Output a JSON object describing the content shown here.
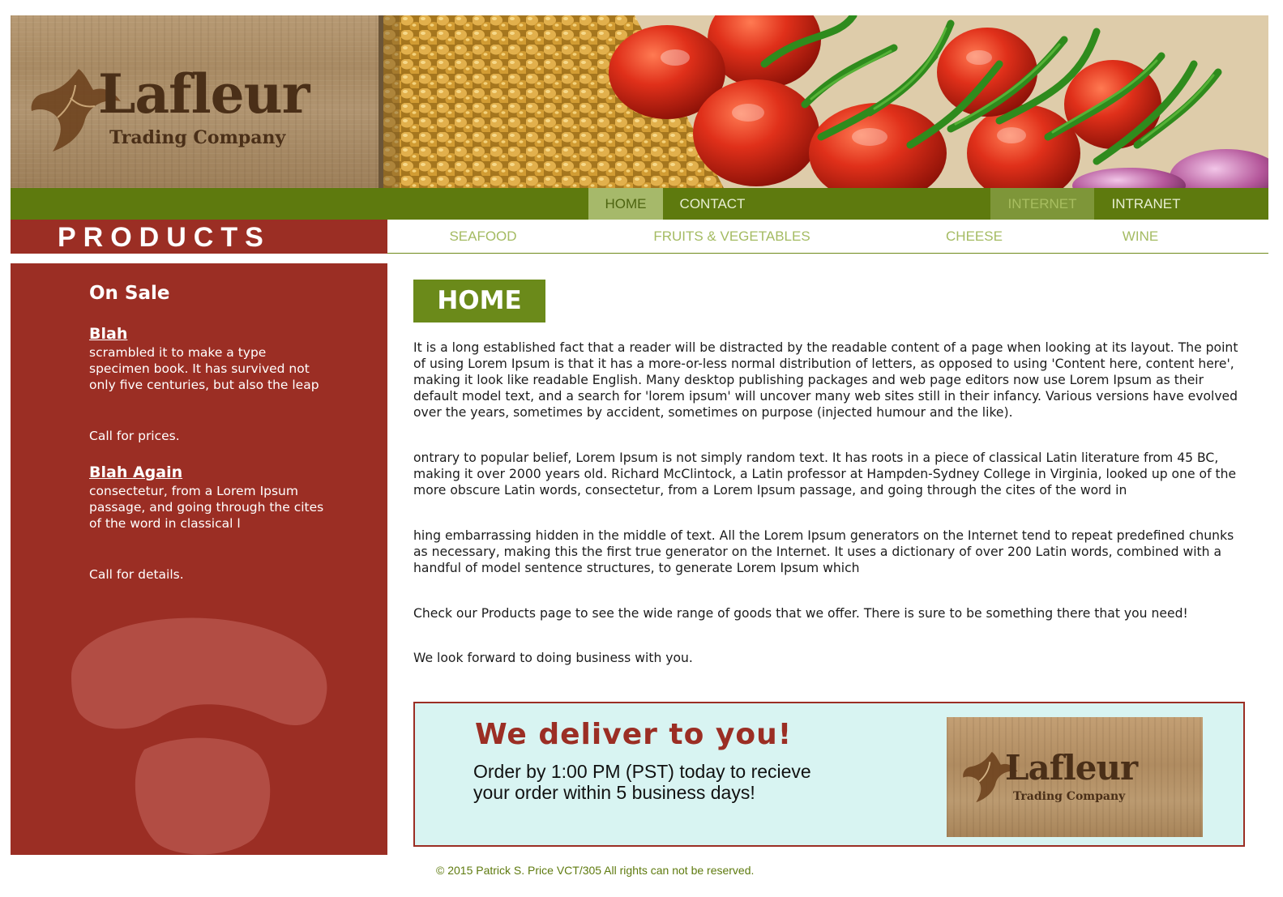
{
  "banner": {
    "logo_word": "Lafleur",
    "logo_sub": "Trading Company"
  },
  "nav": {
    "left": [
      {
        "label": "HOME",
        "active": true
      },
      {
        "label": "CONTACT",
        "active": false
      }
    ],
    "right": [
      {
        "label": "INTERNET",
        "active": true
      },
      {
        "label": "INTRANET",
        "active": false
      }
    ]
  },
  "products": {
    "title": "PRODUCTS",
    "categories": [
      "SEAFOOD",
      "FRUITS & VEGETABLES",
      "CHEESE",
      "WINE"
    ]
  },
  "sidebar": {
    "title": "On Sale",
    "items": [
      {
        "heading": "Blah",
        "text": "scrambled it to make a type specimen book. It has survived not only five centuries, but also the leap",
        "call": "Call for prices."
      },
      {
        "heading": "Blah Again",
        "text": "consectetur, from a Lorem Ipsum passage, and going through the cites of the word in classical l",
        "call": "Call for details."
      }
    ]
  },
  "main": {
    "heading": "HOME",
    "paragraphs": [
      "It is a long established fact that a reader will be distracted by the readable content of a page when looking at its layout. The point of using Lorem Ipsum is that it has a more-or-less normal distribution of letters, as opposed to using 'Content here, content here', making it look like readable English. Many desktop publishing packages and web page editors now use Lorem Ipsum as their default model text, and a search for 'lorem ipsum' will uncover many web sites still in their infancy. Various versions have evolved over the years, sometimes by accident, sometimes on purpose (injected humour and the like).",
      "ontrary to popular belief, Lorem Ipsum is not simply random text. It has roots in a piece of classical Latin literature from 45 BC, making it over 2000 years old. Richard McClintock, a Latin professor at Hampden-Sydney College in Virginia, looked up one of the more obscure Latin words, consectetur, from a Lorem Ipsum passage, and going through the cites of the word in",
      "hing embarrassing hidden in the middle of text. All the Lorem Ipsum generators on the Internet tend to repeat predefined chunks as necessary, making this the first true generator on the Internet. It uses a dictionary of over 200 Latin words, combined with a handful of model sentence structures, to generate Lorem Ipsum which",
      "Check our Products page to see the wide range of goods that we offer. There is sure to be something there that you need!",
      "We look forward to doing business with you."
    ]
  },
  "delivery": {
    "heading": "We deliver to you!",
    "text": "Order by 1:00 PM (PST) today to recieve your order within 5 business days!",
    "logo_word": "Lafleur",
    "logo_sub": "Trading Company"
  },
  "footer": {
    "text": "© 2015 Patrick S. Price VCT/305 All rights can not be reserved."
  },
  "colors": {
    "brand_red": "#9b2e24",
    "brand_green": "#5e7a0e",
    "light_green": "#a6b96a",
    "delivery_bg": "#d8f4f2"
  }
}
